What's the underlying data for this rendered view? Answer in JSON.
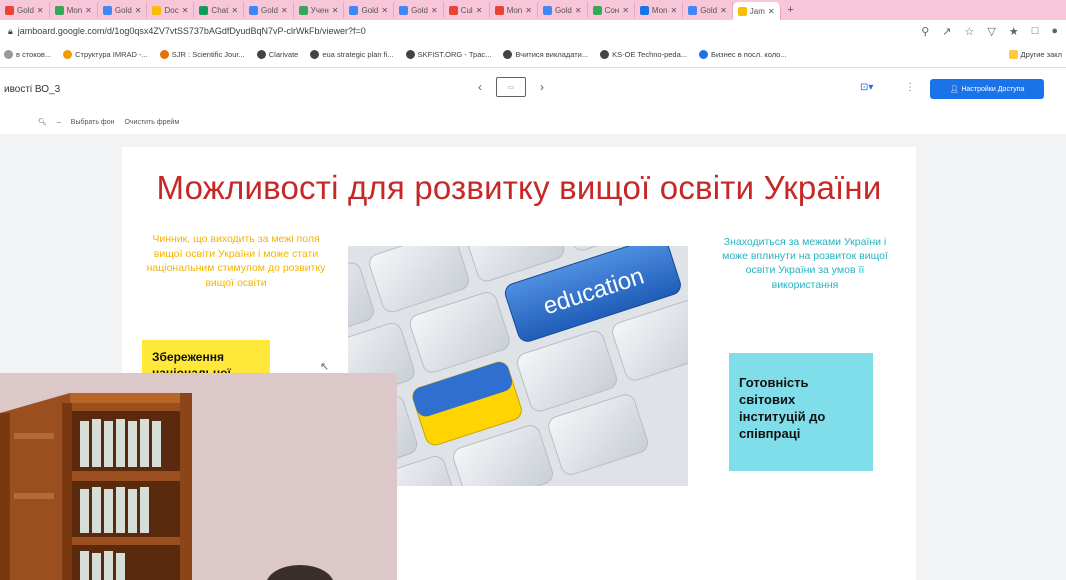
{
  "browser": {
    "tabs": [
      {
        "label": "Gold",
        "color": "#e94335"
      },
      {
        "label": "Mon",
        "color": "#34a853"
      },
      {
        "label": "Gold",
        "color": "#4285f4"
      },
      {
        "label": "Doc",
        "color": "#fbbc04"
      },
      {
        "label": "Сhat",
        "color": "#0f9d58"
      },
      {
        "label": "Gold",
        "color": "#4285f4"
      },
      {
        "label": "Учен",
        "color": "#34a853"
      },
      {
        "label": "Gold",
        "color": "#4285f4"
      },
      {
        "label": "Gold",
        "color": "#4285f4"
      },
      {
        "label": "Cul",
        "color": "#e94335"
      },
      {
        "label": "Mon",
        "color": "#e94335"
      },
      {
        "label": "Gold",
        "color": "#4285f4"
      },
      {
        "label": "Сон",
        "color": "#34a853"
      },
      {
        "label": "Mon",
        "color": "#1a73e8"
      },
      {
        "label": "Gold",
        "color": "#4285f4"
      }
    ],
    "active_tab_label": "Jam",
    "new_tab_label": "+",
    "url": "jamboard.google.com/d/1og0qsx4ZV7vtSS737bAGdfDyudBqN7vP-clrWkFb/viewer?f=0",
    "bookmarks": [
      {
        "label": "в стоков...",
        "color": "#999999"
      },
      {
        "label": "Структура IMRAD -...",
        "color": "#f29900"
      },
      {
        "label": "SJR : Scientific Jour...",
        "color": "#e8710a"
      },
      {
        "label": "Clarivate",
        "color": "#444444"
      },
      {
        "label": "eua strategic plan fi...",
        "color": "#444444"
      },
      {
        "label": "SKFIST.ORG - Трас...",
        "color": "#444444"
      },
      {
        "label": "Вчитися викладати...",
        "color": "#444444"
      },
      {
        "label": "KS-OE Techno-peda...",
        "color": "#444444"
      },
      {
        "label": "Бизнес в посл. коло...",
        "color": "#1a73e8"
      }
    ],
    "other_bookmarks": "Другие закл"
  },
  "app": {
    "file_title": "ивості ВО_3",
    "set_background": "Выбрать фон",
    "clear_frame": "Очистить фрейм",
    "share_label": "Настройки Доступа",
    "frame_glyph": "⊡▾",
    "info_glyph": "⋮"
  },
  "slide": {
    "title": "Можливості для розвитку вищої освіти України",
    "note_left": "Чинник, що виходить за межі поля вищої освіти України і може стати національним стимулом до розвитку вищої освіти",
    "note_right": "Знаходиться за межами України і може вплинути на розвиток вищої освіти України за умов її використання",
    "sticky_yellow": "Збереження національної",
    "sticky_cyan": "Готовність світових інституцій до співпраці",
    "image_key_label": "education"
  },
  "colors": {
    "title_red": "#c62828",
    "note_yellow": "#f5b400",
    "note_cyan": "#26b3c2",
    "sticky_yellow": "#ffe83a",
    "sticky_cyan": "#80deea",
    "share_blue": "#1a73e8"
  }
}
